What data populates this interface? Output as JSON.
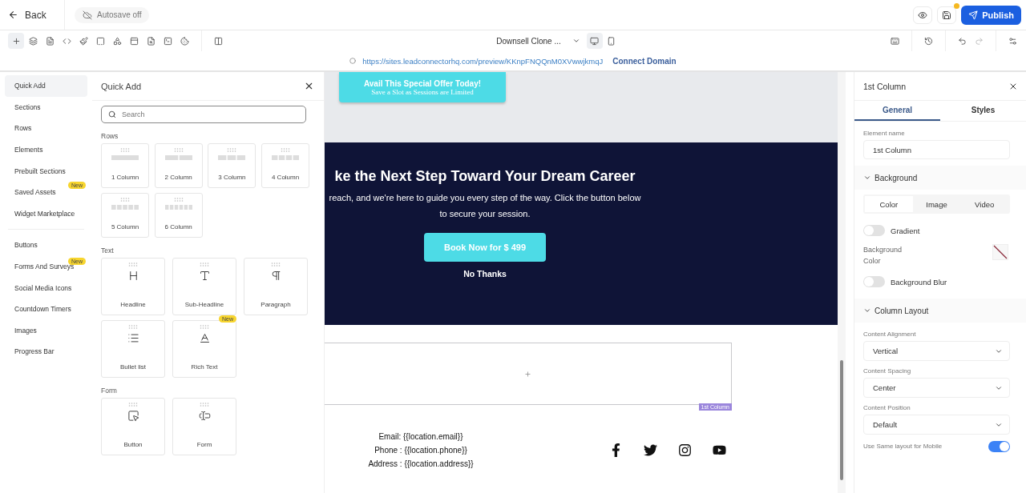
{
  "top_bar": {
    "back": "Back",
    "autosave": "Autosave off",
    "unsaved": true,
    "publish": "Publish"
  },
  "toolbar": {
    "page_select": "Downsell Clone ...",
    "devices": [
      {
        "kind": "desktop",
        "selected": true
      },
      {
        "kind": "mobile",
        "selected": false
      }
    ],
    "redo_disabled": true
  },
  "url_bar": {
    "url": "https://sites.leadconnectorhq.com/preview/KKnpFNQQnM0XVwwjkmqJ",
    "link": "Connect Domain"
  },
  "nav": {
    "groups": [
      [
        {
          "label": "Quick Add",
          "selected": true
        },
        {
          "label": "Sections",
          "selected": false
        },
        {
          "label": "Rows",
          "selected": false
        },
        {
          "label": "Elements",
          "selected": false
        },
        {
          "label": "Prebuilt Sections",
          "selected": false
        },
        {
          "label": "Saved Assets",
          "selected": false,
          "badge": "New"
        },
        {
          "label": "Widget Marketplace",
          "selected": false
        }
      ],
      [
        {
          "label": "Buttons",
          "selected": false
        },
        {
          "label": "Forms And Surveys",
          "selected": false,
          "badge": "New"
        },
        {
          "label": "Social Media Icons",
          "selected": false
        },
        {
          "label": "Countdown Timers",
          "selected": false
        },
        {
          "label": "Images",
          "selected": false
        },
        {
          "label": "Progress Bar",
          "selected": false
        }
      ]
    ]
  },
  "quick_add": {
    "title": "Quick Add",
    "search": {
      "placeholder": "Search"
    },
    "sections": [
      {
        "title": "Rows",
        "kind": "rows",
        "items": [
          {
            "label": "1 Column",
            "kind": "row"
          },
          {
            "label": "2 Column",
            "kind": "row"
          },
          {
            "label": "3 Column",
            "kind": "row"
          },
          {
            "label": "4 Column",
            "kind": "row"
          },
          {
            "label": "5 Column",
            "kind": "row"
          },
          {
            "label": "6 Column",
            "kind": "row"
          }
        ]
      },
      {
        "title": "Text",
        "kind": "elements",
        "items": [
          {
            "label": "Headline",
            "kind": "headline"
          },
          {
            "label": "Sub-Headline",
            "kind": "subheadline"
          },
          {
            "label": "Paragraph",
            "kind": "paragraph"
          },
          {
            "label": "Bullet list",
            "kind": "bullets"
          },
          {
            "label": "Rich Text",
            "kind": "richtext",
            "badge": "New"
          }
        ]
      },
      {
        "title": "Form",
        "kind": "elements",
        "items": [
          {
            "label": "Button",
            "kind": "button"
          },
          {
            "label": "Form",
            "kind": "form"
          }
        ]
      }
    ]
  },
  "canvas": {
    "offer": {
      "title": "Avail This Special Offer Today!",
      "subtitle": "Save a Slot as Sessions are Limited"
    },
    "cta": {
      "headline": "ke the Next Step Toward Your Dream Career",
      "body": "reach, and we're here to guide you every step of the way. Click the button below to secure your session.",
      "button": "Book Now for $ 499",
      "decline": "No Thanks"
    },
    "empty_row": {
      "tag": "1st Column"
    },
    "footer": {
      "contacts": [
        "Email: {{location.email}}",
        "Phone : {{location.phone}}",
        "Address : {{location.address}}"
      ],
      "social": [
        {
          "kind": "facebook"
        },
        {
          "kind": "twitter"
        },
        {
          "kind": "instagram"
        },
        {
          "kind": "youtube"
        }
      ]
    }
  },
  "properties": {
    "title": "1st Column",
    "tabs": [
      {
        "label": "General",
        "selected": true
      },
      {
        "label": "Styles",
        "selected": false
      }
    ],
    "element_name": {
      "label": "Element name",
      "value": "1st Column"
    },
    "background": {
      "title": "Background",
      "expanded": true,
      "modes": [
        {
          "label": "Color",
          "selected": true
        },
        {
          "label": "Image",
          "selected": false
        },
        {
          "label": "Video",
          "selected": false
        }
      ],
      "gradient": {
        "label": "Gradient",
        "on": false
      },
      "color": {
        "label": "Background Color"
      },
      "blur": {
        "label": "Background Blur",
        "on": false
      }
    },
    "layout": {
      "title": "Column Layout",
      "expanded": true,
      "selects": [
        {
          "label": "Content Alignment",
          "value": "Vertical"
        },
        {
          "label": "Content Spacing",
          "value": "Center"
        },
        {
          "label": "Content Position",
          "value": "Default"
        }
      ],
      "mobile": {
        "label": "Use Same layout for Mobile",
        "on": true
      }
    }
  }
}
